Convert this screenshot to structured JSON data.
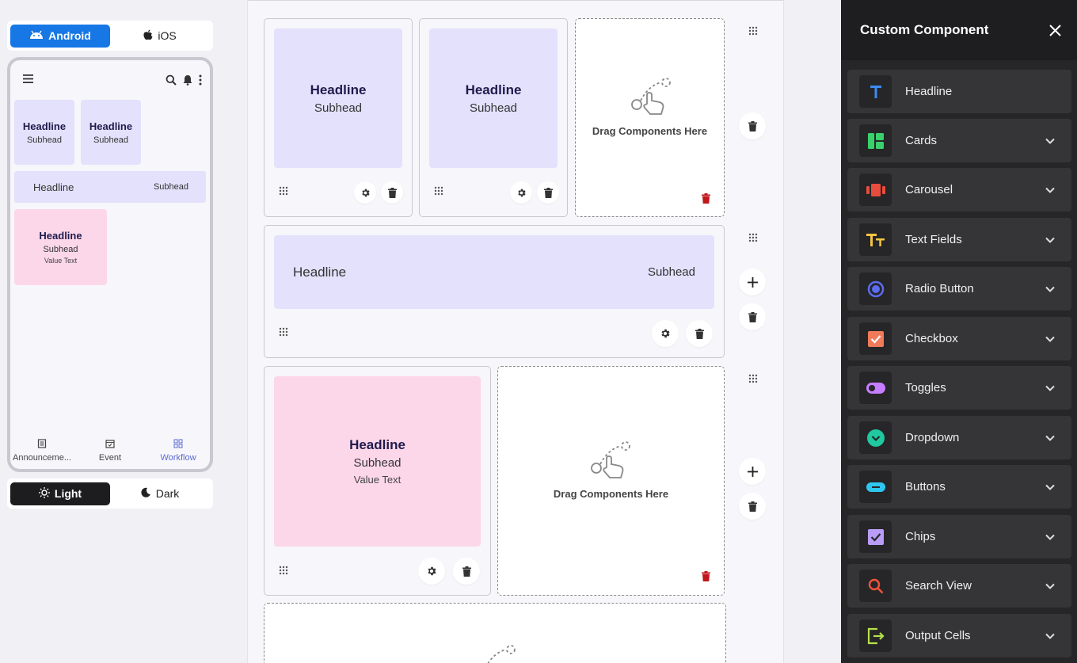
{
  "preview": {
    "os_toggle": {
      "android": "Android",
      "ios": "iOS",
      "selected": "Android"
    },
    "phone": {
      "cards_row": [
        {
          "headline": "Headline",
          "subhead": "Subhead"
        },
        {
          "headline": "Headline",
          "subhead": "Subhead"
        }
      ],
      "bar": {
        "headline": "Headline",
        "subhead": "Subhead"
      },
      "pink_card": {
        "headline": "Headline",
        "subhead": "Subhead",
        "value": "Value Text"
      },
      "nav": [
        {
          "label": "Announceme...",
          "icon": "document-icon"
        },
        {
          "label": "Event",
          "icon": "calendar-icon"
        },
        {
          "label": "Workflow",
          "icon": "workflow-icon",
          "active": true
        }
      ]
    },
    "theme_toggle": {
      "light": "Light",
      "dark": "Dark",
      "selected": "Light"
    }
  },
  "canvas": {
    "row1": {
      "cards": [
        {
          "headline": "Headline",
          "subhead": "Subhead"
        },
        {
          "headline": "Headline",
          "subhead": "Subhead"
        }
      ],
      "drop_text": "Drag Components Here"
    },
    "row2": {
      "headline": "Headline",
      "subhead": "Subhead"
    },
    "row3": {
      "card": {
        "headline": "Headline",
        "subhead": "Subhead",
        "value": "Value Text"
      },
      "drop_text": "Drag Components Here"
    }
  },
  "panel": {
    "title": "Custom Component",
    "items": [
      {
        "label": "Headline",
        "icon": "text-t-icon",
        "color": "#3b8cf0",
        "expandable": false
      },
      {
        "label": "Cards",
        "icon": "cards-icon",
        "color": "#39d16b",
        "expandable": true
      },
      {
        "label": "Carousel",
        "icon": "carousel-icon",
        "color": "#e74c3c",
        "expandable": true
      },
      {
        "label": "Text Fields",
        "icon": "text-fields-icon",
        "color": "#f5c542",
        "expandable": true
      },
      {
        "label": "Radio Button",
        "icon": "radio-icon",
        "color": "#5b6cf0",
        "expandable": true
      },
      {
        "label": "Checkbox",
        "icon": "checkbox-icon",
        "color": "#f07b5a",
        "expandable": true
      },
      {
        "label": "Toggles",
        "icon": "toggle-icon",
        "color": "#c77dff",
        "expandable": true
      },
      {
        "label": "Dropdown",
        "icon": "dropdown-icon",
        "color": "#20c9a0",
        "expandable": true
      },
      {
        "label": "Buttons",
        "icon": "button-icon",
        "color": "#2ec7f0",
        "expandable": true
      },
      {
        "label": "Chips",
        "icon": "chips-icon",
        "color": "#b89cf7",
        "expandable": true
      },
      {
        "label": "Search View",
        "icon": "search-icon",
        "color": "#f0533b",
        "expandable": true
      },
      {
        "label": "Output Cells",
        "icon": "output-icon",
        "color": "#b6e04a",
        "expandable": true
      }
    ]
  }
}
